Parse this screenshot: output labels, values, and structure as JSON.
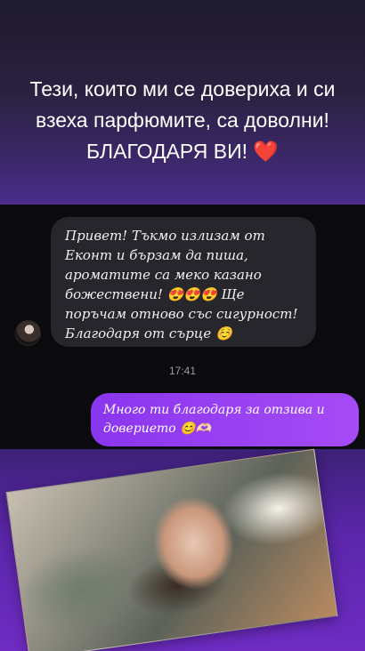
{
  "story": {
    "headline": "Тези, които ми се довериха и си взеха парфюмите, са доволни! БЛАГОДАРЯ ВИ!",
    "heart": "❤️"
  },
  "chat": {
    "incoming_message": "Привет! Тъкмо излизам от Еконт и бързам да пиша, ароматите са меко казано божествени! 😍😍😍 Ще поръчам отново със сигурност! Благодаря от сърце ☺️",
    "timestamp": "17:41",
    "outgoing_message": "Много ти благодаря за отзива и доверието 😊🫶🏻"
  },
  "colors": {
    "outgoing_bubble": "#9a40f2",
    "incoming_bubble": "#26262c",
    "heart": "#e02b3a"
  }
}
